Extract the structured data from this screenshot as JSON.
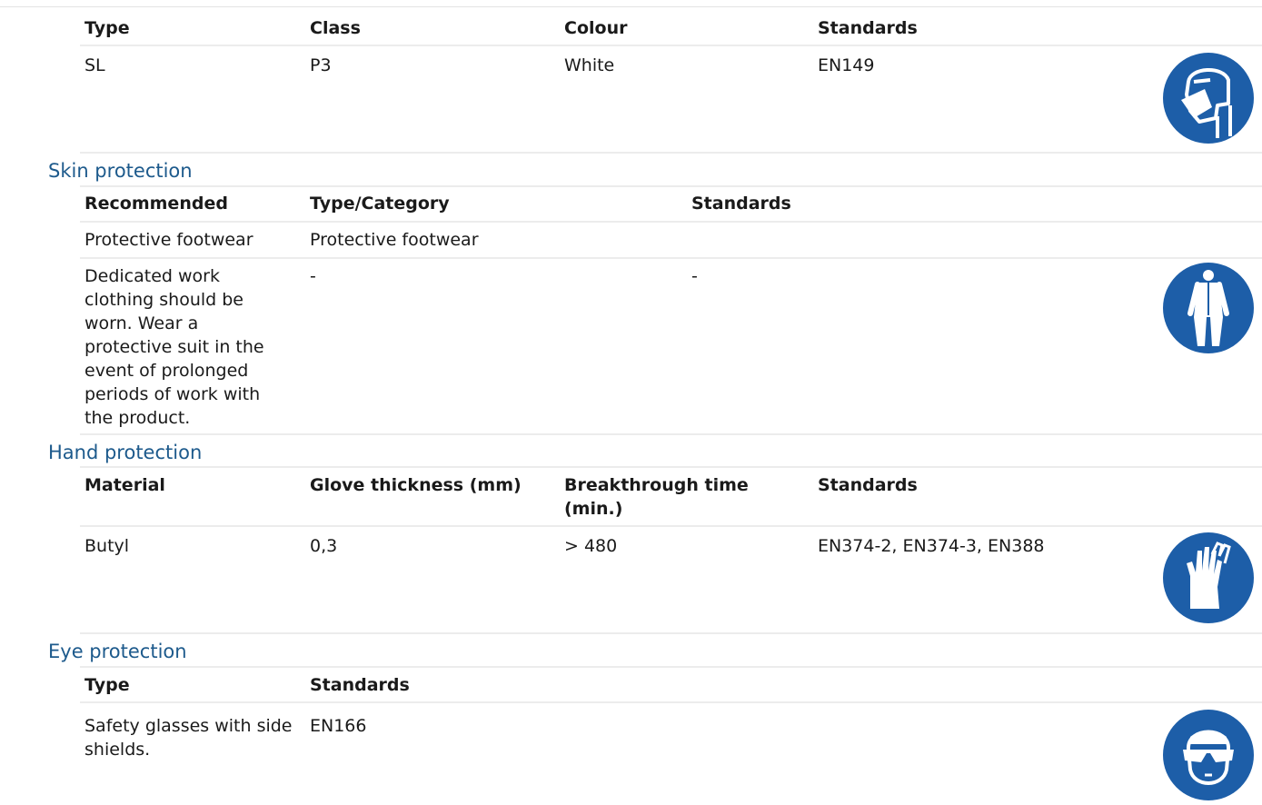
{
  "respiratory": {
    "headers": [
      "Type",
      "Class",
      "Colour",
      "Standards"
    ],
    "row": [
      "SL",
      "P3",
      "White",
      "EN149"
    ]
  },
  "skin": {
    "title": "Skin protection",
    "headers": [
      "Recommended",
      "Type/Category",
      "Standards"
    ],
    "rows": [
      [
        "Protective footwear",
        "Protective footwear",
        ""
      ],
      [
        "Dedicated work clothing should be worn. Wear a protective suit in the event of prolonged periods of work with the product.",
        "-",
        "-"
      ]
    ]
  },
  "hand": {
    "title": "Hand protection",
    "headers": [
      "Material",
      "Glove thickness (mm)",
      "Breakthrough time (min.)",
      "Standards"
    ],
    "row": [
      "Butyl",
      "0,3",
      "> 480",
      "EN374-2, EN374-3, EN388"
    ]
  },
  "eye": {
    "title": "Eye protection",
    "headers": [
      "Type",
      "Standards"
    ],
    "row": [
      "Safety glasses with side shields.",
      "EN166"
    ]
  },
  "icons": {
    "respirator": "respirator-mask-icon",
    "suit": "protective-suit-icon",
    "gloves": "gloves-icon",
    "glasses": "safety-glasses-icon"
  },
  "colors": {
    "pictogram": "#1d5ea8",
    "section_title": "#1d5a8c",
    "rule": "#ececec"
  }
}
